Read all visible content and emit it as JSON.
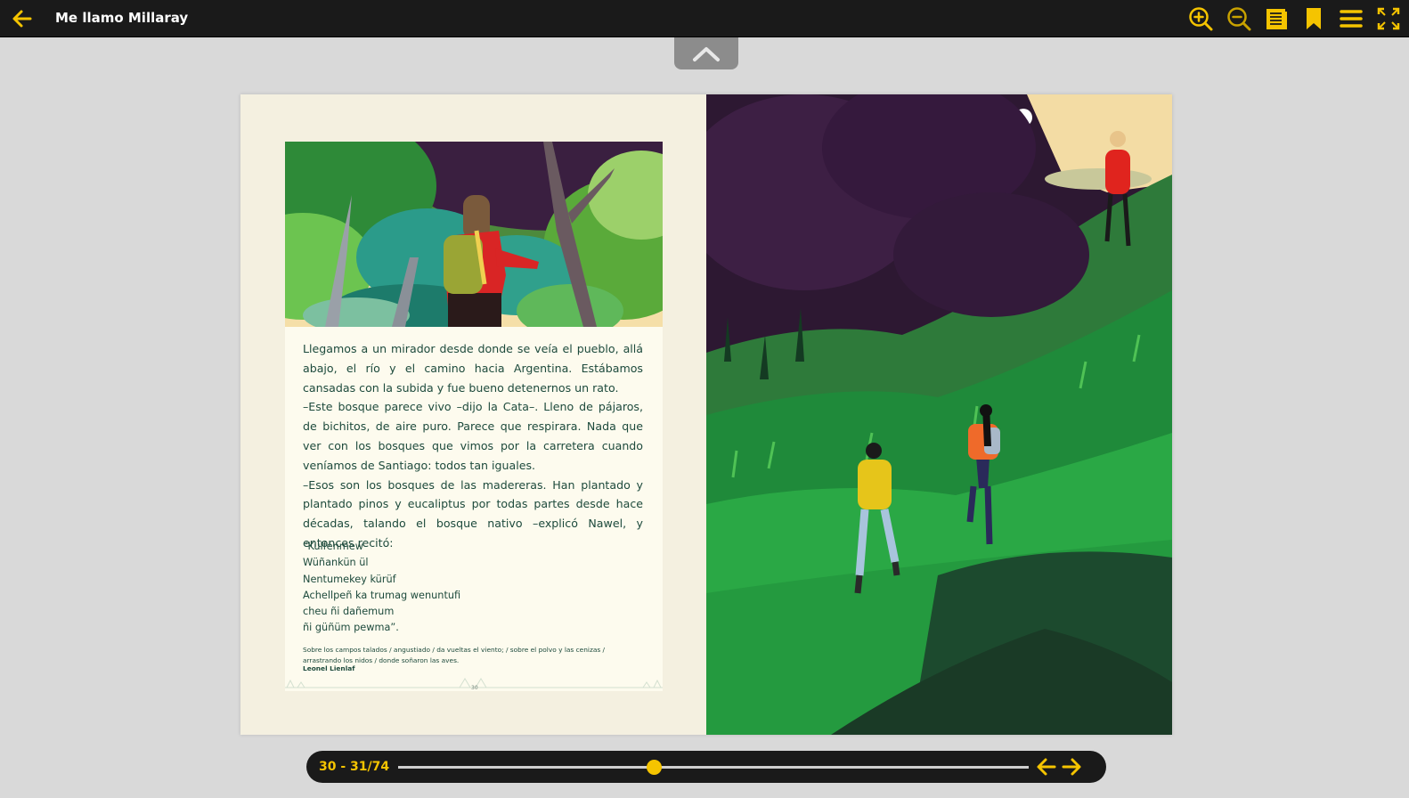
{
  "app": {
    "title": "Me llamo Millaray",
    "accent": "#f5c400",
    "bar_color": "#1a1a1a",
    "background": "#d9d9d9"
  },
  "toolbar": {
    "back_icon": "arrow-left-icon",
    "tools": [
      "zoom-in-icon",
      "zoom-out-icon",
      "table-of-contents-icon",
      "bookmark-icon",
      "menu-icon",
      "fullscreen-icon"
    ]
  },
  "collapse_icon": "chevron-up-icon",
  "book": {
    "left_page": {
      "paragraphs": [
        "Llegamos a un mirador desde donde se veía el pueblo, allá abajo, el río y el camino hacia Argentina. Estábamos cansadas con la subida y fue bueno detenernos un rato.",
        "–Este bosque parece vivo –dijo la Cata–. Lleno de pájaros, de bichitos, de aire puro. Parece que respirara. Nada que ver con los bosques que vimos por la carretera cuando veníamos de Santiago: todos tan iguales.",
        "–Esos son los bosques de las madereras. Han plantado y plantado pinos y eucaliptus por todas partes desde hace décadas, talando el bosque nativo –explicó Nawel, y entonces recitó:"
      ],
      "poem_lines": [
        "“Kulfenmew",
        "Wüñankün ül",
        "Nentumekey kürüf",
        "Achellpeñ ka trumag wenuntufi",
        "cheu ñi dañemum",
        "ñi güñüm pewma”."
      ],
      "translation_lines": [
        "Sobre los campos talados / angustiado / da vueltas el viento; / sobre el polvo y las cenizas /",
        "arrastrando los nidos / donde soñaron las aves."
      ],
      "author": "Leonel Lienlaf",
      "page_number": "30"
    }
  },
  "footer": {
    "page_indicator": "30 - 31/74",
    "progress": 0.405,
    "prev_icon": "arrow-left-icon",
    "next_icon": "arrow-right-icon"
  }
}
